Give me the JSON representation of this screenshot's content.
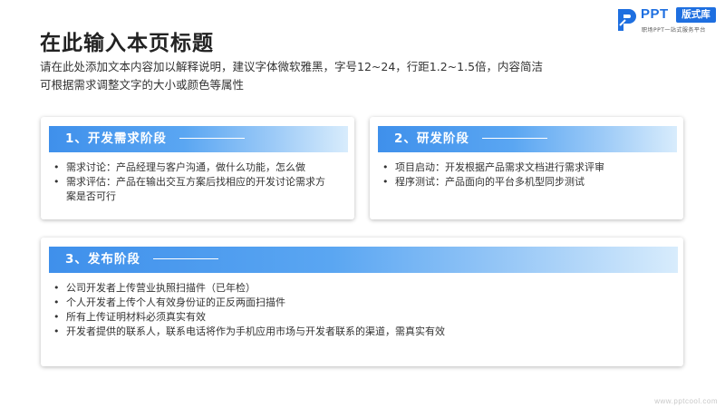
{
  "header": {
    "title": "在此输入本页标题",
    "description_lines": [
      "请在此处添加文本内容加以解释说明，建议字体微软雅黑，字号12~24，行距1.2~1.5倍，内容简洁",
      "可根据需求调整文字的大小或颜色等属性"
    ]
  },
  "logo": {
    "brand": "PPT",
    "badge": "版式库",
    "subtitle": "职场PPT一站式服务平台",
    "color": "#1e6fe0"
  },
  "cards": [
    {
      "title": "1、开发需求阶段",
      "items": [
        [
          "需求讨论：产品经理与客户沟通，做什么功能，怎么做"
        ],
        [
          "需求评估：产品在输出交互方案后找相应的开发讨论需求方",
          "案是否可行"
        ]
      ]
    },
    {
      "title": "2、研发阶段",
      "items": [
        [
          "项目启动：开发根据产品需求文档进行需求评审"
        ],
        [
          "程序测试：产品面向的平台多机型同步测试"
        ]
      ]
    },
    {
      "title": "3、发布阶段",
      "items": [
        [
          "公司开发者上传营业执照扫描件（已年检）"
        ],
        [
          "个人开发者上传个人有效身份证的正反两面扫描件"
        ],
        [
          "所有上传证明材料必须真实有效"
        ],
        [
          "开发者提供的联系人，联系电话将作为手机应用市场与开发者联系的渠道，需真实有效"
        ]
      ]
    }
  ],
  "footer": {
    "watermark": "www.pptcool.com"
  },
  "colors": {
    "accent": "#3f90eb",
    "text": "#333333"
  }
}
